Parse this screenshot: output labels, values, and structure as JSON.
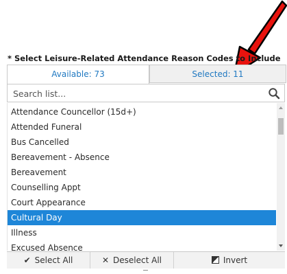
{
  "field": {
    "label": "* Select Leisure-Related Attendance Reason Codes to Include"
  },
  "tabs": {
    "available": "Available: 73",
    "selected": "Selected: 11"
  },
  "search": {
    "placeholder": "Search list..."
  },
  "list": {
    "items": [
      "Attendance Councellor (15d+)",
      "Attended Funeral",
      "Bus Cancelled",
      "Bereavement - Absence",
      "Bereavement",
      "Counselling Appt",
      "Court Appearance",
      "Cultural Day",
      "Illness",
      "Excused Absence"
    ],
    "highlighted_item": "Cultural Day"
  },
  "actions": {
    "select_all": "Select All",
    "deselect_all": "Deselect All",
    "invert": "Invert"
  },
  "icons": {
    "select_all": "checkmark-icon",
    "deselect_all": "x-icon",
    "invert": "invert-icon",
    "search": "search-icon",
    "annotation": "arrow-icon"
  },
  "colors": {
    "accent": "#1f78c1",
    "highlight": "#1e86d8",
    "annotation_arrow": "#e8130e"
  }
}
